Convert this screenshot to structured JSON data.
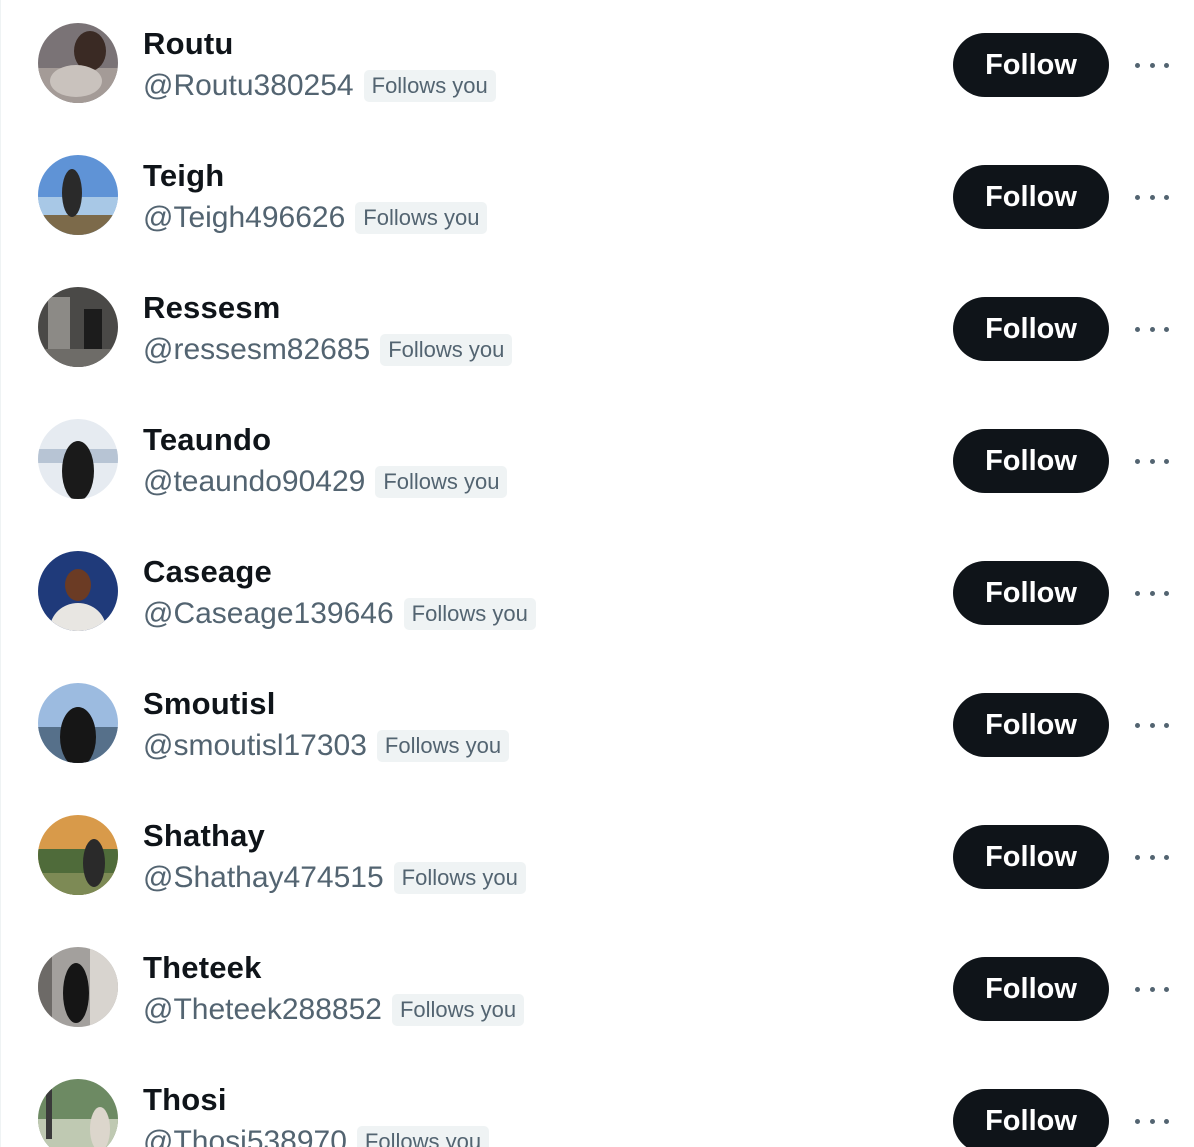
{
  "accounts": [
    {
      "name": "Routu",
      "handle": "@Routu380254",
      "badge": "Follows you",
      "button": "Follow",
      "avatar_colors": [
        "#6f6a6d",
        "#a59c98",
        "#3a2a24"
      ]
    },
    {
      "name": "Teigh",
      "handle": "@Teigh496626",
      "badge": "Follows you",
      "button": "Follow",
      "avatar_colors": [
        "#4a7fc9",
        "#9fc2e6",
        "#2b2b2b"
      ]
    },
    {
      "name": "Ressesm",
      "handle": "@ressesm82685",
      "badge": "Follows you",
      "button": "Follow",
      "avatar_colors": [
        "#3d3d3d",
        "#8c8a86",
        "#1c1c1c"
      ]
    },
    {
      "name": "Teaundo",
      "handle": "@teaundo90429",
      "badge": "Follows you",
      "button": "Follow",
      "avatar_colors": [
        "#dfe6ee",
        "#b9c6d6",
        "#1a1a1a"
      ]
    },
    {
      "name": "Caseage",
      "handle": "@Caseage139646",
      "badge": "Follows you",
      "button": "Follow",
      "avatar_colors": [
        "#1f3a7a",
        "#e8e6e2",
        "#6b3b24"
      ]
    },
    {
      "name": "Smoutisl",
      "handle": "@smoutisl17303",
      "badge": "Follows you",
      "button": "Follow",
      "avatar_colors": [
        "#8fb2d8",
        "#56708a",
        "#161616"
      ]
    },
    {
      "name": "Shathay",
      "handle": "@Shathay474515",
      "badge": "Follows you",
      "button": "Follow",
      "avatar_colors": [
        "#d89a4a",
        "#4f6b3a",
        "#2a2a2a"
      ]
    },
    {
      "name": "Theteek",
      "handle": "@Theteek288852",
      "badge": "Follows you",
      "button": "Follow",
      "avatar_colors": [
        "#9a9896",
        "#d8d4cf",
        "#151515"
      ]
    },
    {
      "name": "Thosi",
      "handle": "@Thosi538970",
      "badge": "Follows you",
      "button": "Follow",
      "avatar_colors": [
        "#6d8a63",
        "#bfc9b2",
        "#3a3a3a"
      ]
    }
  ],
  "icons": {
    "avatar": "avatar-photo",
    "more": "more-options-icon"
  }
}
